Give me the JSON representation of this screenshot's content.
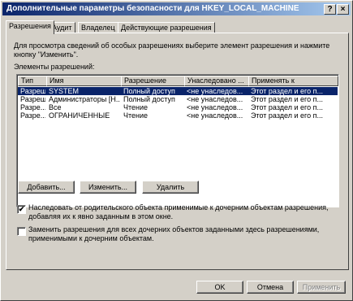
{
  "window": {
    "title": "Дополнительные параметры безопасности для HKEY_LOCAL_MACHINE",
    "help_label": "?",
    "close_label": "×"
  },
  "tabs": [
    {
      "label": "Разрешения",
      "active": true
    },
    {
      "label": "Аудит",
      "active": false
    },
    {
      "label": "Владелец",
      "active": false
    },
    {
      "label": "Действующие разрешения",
      "active": false
    }
  ],
  "panel": {
    "description": "Для просмотра сведений об особых разрешениях выберите элемент разрешения и нажмите кнопку \"Изменить\".",
    "list_label": "Элементы разрешений:"
  },
  "table": {
    "columns": [
      "Тип",
      "Имя",
      "Разрешение",
      "Унаследовано ...",
      "Применять к"
    ],
    "rows": [
      {
        "type": "Разреше...",
        "name": "SYSTEM",
        "permission": "Полный доступ",
        "inherited": "<не унаследов...",
        "apply_to": "Этот раздел и его п...",
        "selected": true
      },
      {
        "type": "Разреше...",
        "name": "Администраторы [Н...",
        "permission": "Полный доступ",
        "inherited": "<не унаследов...",
        "apply_to": "Этот раздел и его п...",
        "selected": false
      },
      {
        "type": "Разре...",
        "name": "Все",
        "permission": "Чтение",
        "inherited": "<не унаследов...",
        "apply_to": "Этот раздел и его п...",
        "selected": false
      },
      {
        "type": "Разре...",
        "name": "ОГРАНИЧЕННЫЕ",
        "permission": "Чтение",
        "inherited": "<не унаследов...",
        "apply_to": "Этот раздел и его п...",
        "selected": false
      }
    ]
  },
  "buttons": {
    "add": "Добавить...",
    "edit": "Изменить...",
    "remove": "Удалить",
    "ok": "OK",
    "cancel": "Отмена",
    "apply": "Применить"
  },
  "options": {
    "inherit": {
      "label": "Наследовать от родительского объекта применимые к дочерним объектам разрешения, добавляя их к явно заданным в этом окне.",
      "checked": true,
      "mark": "✔"
    },
    "replace": {
      "label": "Заменить разрешения для всех дочерних объектов заданными здесь разрешениями, применимыми к дочерним объектам.",
      "checked": false,
      "mark": ""
    }
  }
}
